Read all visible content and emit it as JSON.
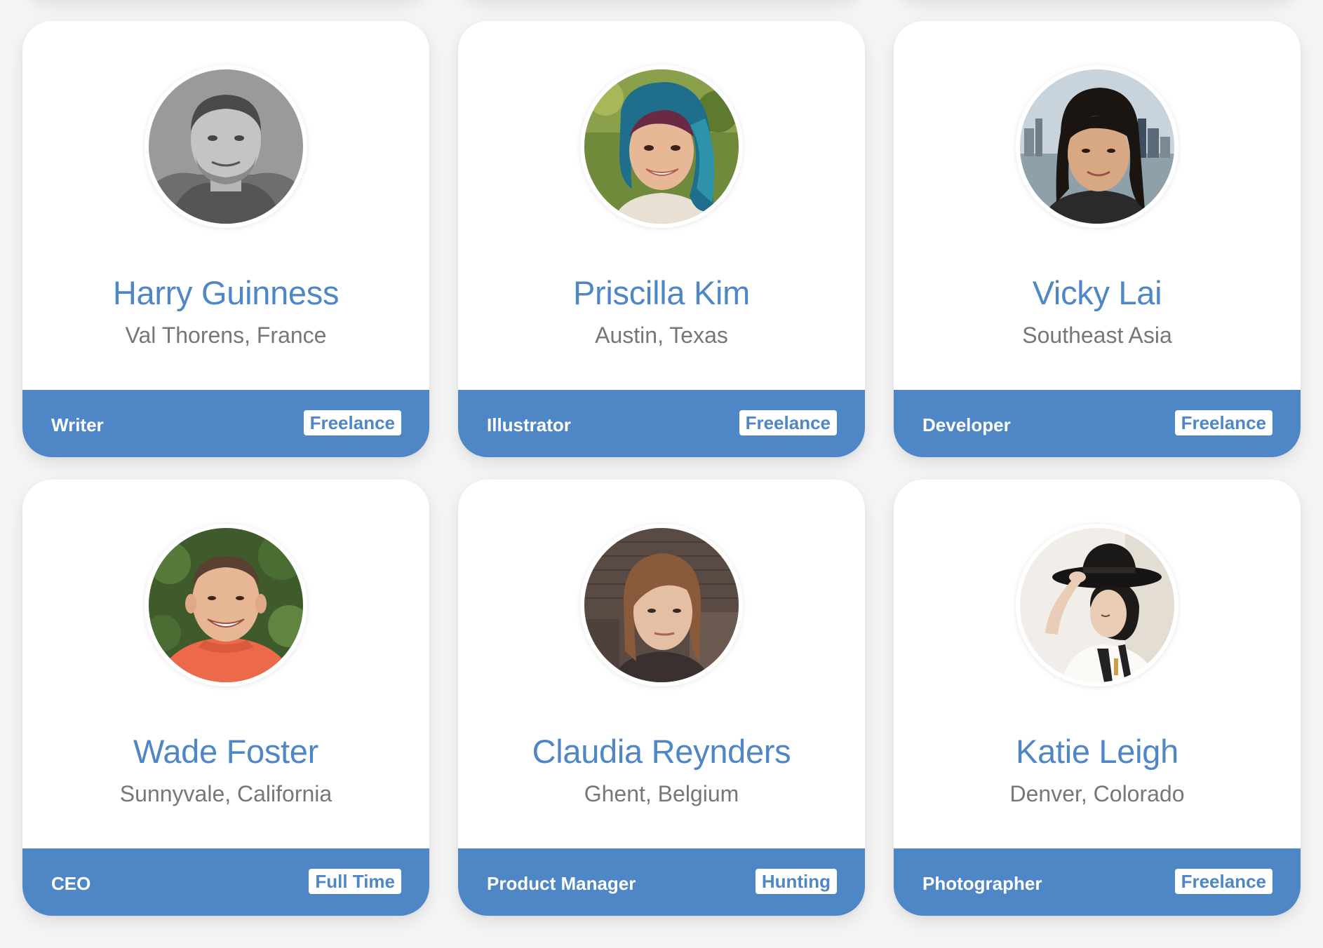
{
  "theme": {
    "accent": "#4f86c6",
    "background": "#f5f5f5",
    "card": "#ffffff",
    "secondary_text": "#777777"
  },
  "profiles": [
    {
      "name": "Harry Guinness",
      "location": "Val Thorens, France",
      "role": "Writer",
      "status": "Freelance",
      "photo": "grayscale-portrait-man-beard-hood"
    },
    {
      "name": "Priscilla Kim",
      "location": "Austin, Texas",
      "role": "Illustrator",
      "status": "Freelance",
      "photo": "portrait-woman-blue-hair"
    },
    {
      "name": "Vicky Lai",
      "location": "Southeast Asia",
      "role": "Developer",
      "status": "Freelance",
      "photo": "portrait-woman-city-skyline"
    },
    {
      "name": "Wade Foster",
      "location": "Sunnyvale, California",
      "role": "CEO",
      "status": "Full Time",
      "photo": "portrait-man-orange-shirt-foliage"
    },
    {
      "name": "Claudia Reynders",
      "location": "Ghent, Belgium",
      "role": "Product Manager",
      "status": "Hunting",
      "photo": "portrait-woman-brick-wall"
    },
    {
      "name": "Katie Leigh",
      "location": "Denver, Colorado",
      "role": "Photographer",
      "status": "Freelance",
      "photo": "portrait-woman-black-hat"
    }
  ]
}
